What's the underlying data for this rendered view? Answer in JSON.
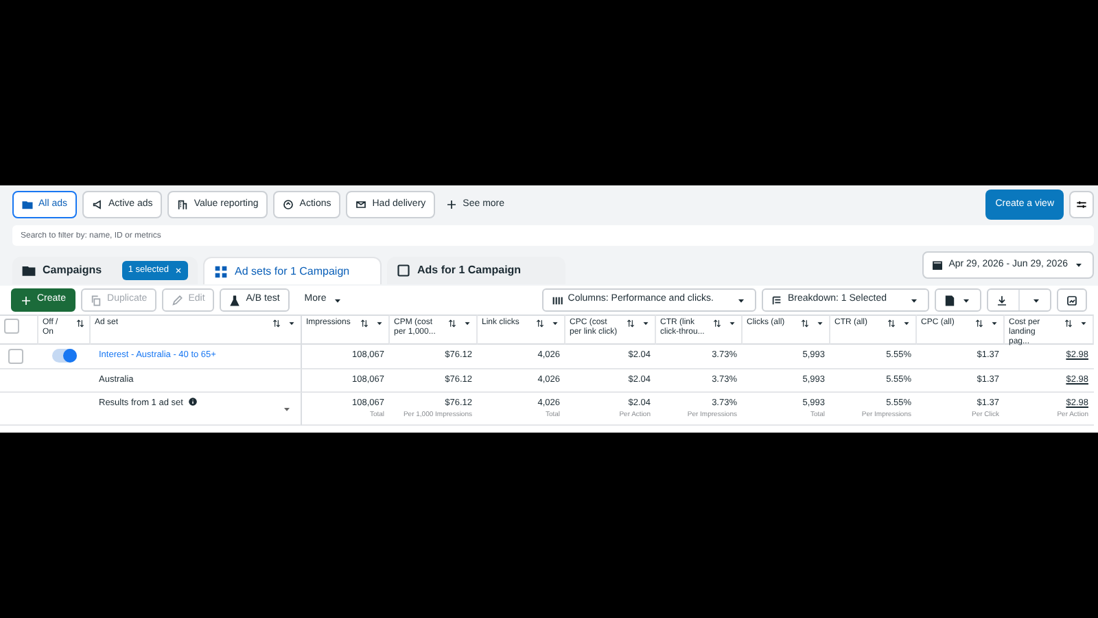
{
  "view_tabs": [
    {
      "label": "All ads",
      "selected": true
    },
    {
      "label": "Active ads",
      "selected": false
    },
    {
      "label": "Value reporting",
      "selected": false
    },
    {
      "label": "Actions",
      "selected": false
    },
    {
      "label": "Had delivery",
      "selected": false
    }
  ],
  "see_more": "See more",
  "create_view": "Create a view",
  "search": {
    "placeholder": "Search to filter by: name, ID or metrics"
  },
  "level_tabs": [
    {
      "label": "Campaigns",
      "selected": false,
      "chip": "1 selected"
    },
    {
      "label": "Ad sets for 1 Campaign",
      "selected": true
    },
    {
      "label": "Ads for 1 Campaign",
      "selected": false
    }
  ],
  "date_range": "Apr 29, 2026 - Jun 29, 2026",
  "toolbar": [
    {
      "label": "Create",
      "kind": "primary"
    },
    {
      "label": "Duplicate",
      "kind": "disabled"
    },
    {
      "label": "Edit",
      "kind": "disabled"
    },
    {
      "label": "A/B test",
      "kind": "outline"
    },
    {
      "label": "More",
      "kind": "menu"
    }
  ],
  "toolbar_right": [
    "Columns: Performance and clicks.",
    "Breakdown: 1 Selected"
  ],
  "table": {
    "select_all": {
      "checked": false
    },
    "columns": [
      {
        "label": "Off / On",
        "caret": false
      },
      {
        "label": "Ad set",
        "caret": true
      },
      {
        "label": "Impressions",
        "caret": true
      },
      {
        "label": "CPM (cost per 1,000...",
        "caret": true
      },
      {
        "label": "Link clicks",
        "caret": true
      },
      {
        "label": "CPC (cost per link click)",
        "caret": true
      },
      {
        "label": "CTR (link click-throu...",
        "caret": true
      },
      {
        "label": "Clicks (all)",
        "caret": true
      },
      {
        "label": "CTR (all)",
        "caret": true
      },
      {
        "label": "CPC (all)",
        "caret": true
      },
      {
        "label": "Cost per landing pag...",
        "caret": true
      }
    ],
    "rows": [
      {
        "kind": "adset",
        "checked": false,
        "on": true,
        "name": "Interest - Australia - 40 to 65+",
        "values": [
          "108,067",
          "$76.12",
          "4,026",
          "$2.04",
          "3.73%",
          "5,993",
          "5.55%",
          "$1.37",
          "$2.98"
        ]
      },
      {
        "kind": "breakdown",
        "name": "Australia",
        "values": [
          "108,067",
          "$76.12",
          "4,026",
          "$2.04",
          "3.73%",
          "5,993",
          "5.55%",
          "$1.37",
          "$2.98"
        ]
      }
    ],
    "totals": {
      "label": "Results from 1 ad set",
      "values": [
        "108,067",
        "$76.12",
        "4,026",
        "$2.04",
        "3.73%",
        "5,993",
        "5.55%",
        "$1.37",
        "$2.98"
      ],
      "notes": [
        "Total",
        "Per 1,000 Impressions",
        "Total",
        "Per Action",
        "Per Impressions",
        "Total",
        "Per Impressions",
        "Per Click",
        "Per Action"
      ]
    }
  }
}
